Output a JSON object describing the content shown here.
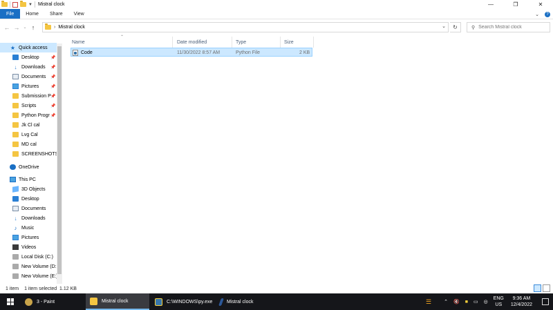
{
  "window": {
    "title": "Mistral clock",
    "minimize": "—",
    "maximize": "❐",
    "close": "✕"
  },
  "ribbon": {
    "tabs": [
      "File",
      "Home",
      "Share",
      "View"
    ]
  },
  "address": {
    "crumb": "Mistral clock",
    "search_placeholder": "Search Mistral clock"
  },
  "navpane": {
    "quick_access": "Quick access",
    "quick_items": [
      {
        "label": "Desktop",
        "icon": "desktop-icon",
        "pinned": true
      },
      {
        "label": "Downloads",
        "icon": "downloads-icon",
        "pinned": true
      },
      {
        "label": "Documents",
        "icon": "documents-icon",
        "pinned": true
      },
      {
        "label": "Pictures",
        "icon": "pictures-icon",
        "pinned": true
      },
      {
        "label": "Submission P",
        "icon": "folder-icon",
        "pinned": true
      },
      {
        "label": "Scripts",
        "icon": "folder-icon",
        "pinned": true
      },
      {
        "label": "Python Progr",
        "icon": "folder-icon",
        "pinned": true
      },
      {
        "label": "Jk Cl cal",
        "icon": "folder-icon",
        "pinned": false
      },
      {
        "label": "Lvg Cal",
        "icon": "folder-icon",
        "pinned": false
      },
      {
        "label": "MD cal",
        "icon": "folder-icon",
        "pinned": false
      },
      {
        "label": "SCREENSHOTS",
        "icon": "folder-icon",
        "pinned": false
      }
    ],
    "onedrive": "OneDrive",
    "this_pc": "This PC",
    "pc_items": [
      {
        "label": "3D Objects",
        "icon": "3d-objects-icon"
      },
      {
        "label": "Desktop",
        "icon": "desktop-icon"
      },
      {
        "label": "Documents",
        "icon": "documents-icon"
      },
      {
        "label": "Downloads",
        "icon": "downloads-icon"
      },
      {
        "label": "Music",
        "icon": "music-icon"
      },
      {
        "label": "Pictures",
        "icon": "pictures-icon"
      },
      {
        "label": "Videos",
        "icon": "videos-icon"
      },
      {
        "label": "Local Disk (C:)",
        "icon": "disk-icon"
      },
      {
        "label": "New Volume (D:",
        "icon": "disk-icon"
      },
      {
        "label": "New Volume (E:)",
        "icon": "disk-icon"
      }
    ]
  },
  "columns": {
    "name": "Name",
    "date": "Date modified",
    "type": "Type",
    "size": "Size"
  },
  "files": [
    {
      "name": "Code",
      "date": "11/30/2022 8:57 AM",
      "type": "Python File",
      "size": "2 KB"
    }
  ],
  "status": {
    "count": "1 item",
    "selected": "1 item selected  1.12 KB"
  },
  "taskbar": {
    "apps": [
      {
        "label": "3 - Paint",
        "icon": "paint-icon",
        "active": false
      },
      {
        "label": "Mistral clock",
        "icon": "file-explorer-icon",
        "active": true
      },
      {
        "label": "C:\\WINDOWS\\py.exe",
        "icon": "python-icon",
        "active": false
      },
      {
        "label": "Mistral clock",
        "icon": "text-editor-icon",
        "active": false
      }
    ],
    "lang_top": "ENG",
    "lang_bottom": "US",
    "time": "9:36 AM",
    "date": "12/4/2022"
  },
  "colors": {
    "accent": "#1a6fc4",
    "selection": "#cce8ff",
    "taskbar": "#15161a"
  }
}
